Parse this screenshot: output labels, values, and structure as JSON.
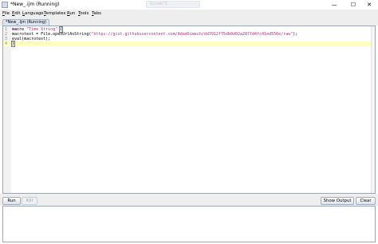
{
  "window": {
    "title": "*New_.ijm (Running)",
    "ghost_label": "Screen S...",
    "controls": {
      "minimize": "—",
      "maximize": "☐",
      "close": "✕"
    }
  },
  "menu": {
    "items": [
      {
        "mnemonic": "F",
        "rest": "ile"
      },
      {
        "mnemonic": "E",
        "rest": "dit"
      },
      {
        "mnemonic": "L",
        "rest": "anguage"
      },
      {
        "mnemonic": "T",
        "rest": "emplates"
      },
      {
        "mnemonic": "R",
        "rest": "un"
      },
      {
        "mnemonic": "T",
        "rest": "ools"
      },
      {
        "mnemonic": "T",
        "rest": "abs"
      }
    ]
  },
  "tab": {
    "label": "*New_.ijm (Running)"
  },
  "editor": {
    "lines": [
      {
        "num": "1",
        "kw": "macro",
        "s1": " ",
        "str": "\"Time String\"",
        "s2": " ",
        "br": "{"
      },
      {
        "num": "2",
        "plain1": "macrotext = ",
        "fn": "File.openUrlAsString",
        "plain2": "(",
        "str": "\"https://gist.githubusercontent.com/AdamSimech/dd3912f75db0d02a287fd4fc41ed556e/raw\"",
        "plain3": ");"
      },
      {
        "num": "3",
        "fn": "eval",
        "plain1": "(macrotext);"
      },
      {
        "num": "4",
        "br": "}"
      }
    ]
  },
  "buttons": {
    "run": "Run",
    "kill": "Kill",
    "show_output": "Show Output",
    "clear": "Clear"
  },
  "output": {
    "text": ""
  }
}
